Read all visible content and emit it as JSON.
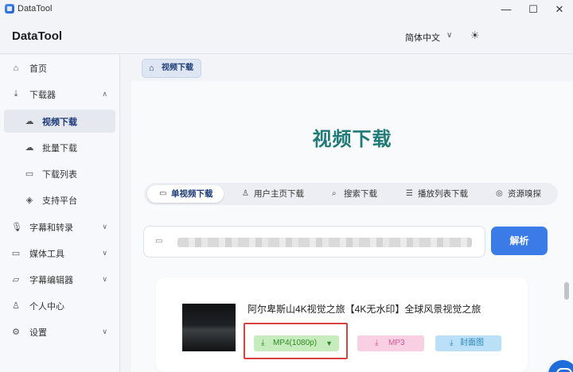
{
  "window": {
    "title": "DataTool",
    "minimize": "—",
    "maximize": "☐",
    "close": "✕"
  },
  "header": {
    "brand": "DataTool",
    "language": "简体中文",
    "language_chevron": "∨",
    "theme_icon": "☀"
  },
  "sidebar": {
    "items": [
      {
        "label": "首页",
        "icon": "home-icon",
        "glyph": "⌂"
      },
      {
        "label": "下载器",
        "icon": "download-icon",
        "glyph": "⤓",
        "chevron": "∧"
      },
      {
        "label": "视频下载",
        "icon": "cloud-download-icon",
        "glyph": "☁",
        "active": true
      },
      {
        "label": "批量下载",
        "icon": "cloud-icon",
        "glyph": "☁"
      },
      {
        "label": "下载列表",
        "icon": "archive-icon",
        "glyph": "▭"
      },
      {
        "label": "支持平台",
        "icon": "cube-icon",
        "glyph": "◈"
      },
      {
        "label": "字幕和转录",
        "icon": "microphone-icon",
        "glyph": "🎙",
        "chevron": "∨"
      },
      {
        "label": "媒体工具",
        "icon": "video-camera-icon",
        "glyph": "▭",
        "chevron": "∨"
      },
      {
        "label": "字幕编辑器",
        "icon": "subtitle-edit-icon",
        "glyph": "▱",
        "chevron": "∨"
      },
      {
        "label": "个人中心",
        "icon": "user-icon",
        "glyph": "♙"
      },
      {
        "label": "设置",
        "icon": "gear-icon",
        "glyph": "⚙",
        "chevron": "∨"
      }
    ]
  },
  "tabbar": {
    "tab_label": "视频下载"
  },
  "main": {
    "title": "视频下载",
    "modes": [
      {
        "label": "单视频下载",
        "icon": "video-icon",
        "glyph": "▭",
        "active": true
      },
      {
        "label": "用户主页下载",
        "icon": "user-icon",
        "glyph": "♙"
      },
      {
        "label": "搜索下载",
        "icon": "search-icon",
        "glyph": "⌕"
      },
      {
        "label": "播放列表下载",
        "icon": "list-icon",
        "glyph": "☰"
      },
      {
        "label": "资源嗅探",
        "icon": "compass-icon",
        "glyph": "◎"
      }
    ],
    "url_input": {
      "placeholder": "",
      "icon_glyph": "▭"
    },
    "parse_button": "解析",
    "result": {
      "title": "阿尔卑斯山4K视觉之旅【4K无水印】全球风景视觉之旅",
      "formats": {
        "mp4": "MP4(1080p)",
        "mp4_caret": "▼",
        "mp3": "MP3",
        "cover": "封面图"
      },
      "download_glyph": "⤓"
    }
  },
  "colors": {
    "accent": "#3a7be8",
    "title_teal": "#1f7a78",
    "mp4_bg": "#c6ecbd",
    "mp3_bg": "#f8cfe3",
    "cover_bg": "#b9e0f7",
    "highlight": "#d6423f"
  }
}
